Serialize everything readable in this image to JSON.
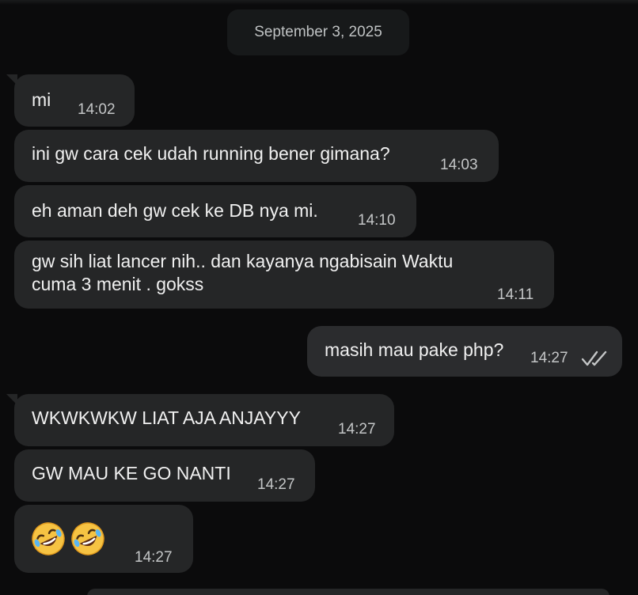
{
  "date_separator": "September 3, 2025",
  "messages": [
    {
      "direction": "in",
      "text": "mi",
      "time": "14:02"
    },
    {
      "direction": "in",
      "text": "ini gw cara cek udah running bener gimana?",
      "time": "14:03"
    },
    {
      "direction": "in",
      "text": "eh aman deh gw cek ke DB nya mi.",
      "time": "14:10"
    },
    {
      "direction": "in",
      "text": "gw sih liat lancer nih.. dan kayanya ngabisain Waktu\ncuma 3 menit . gokss",
      "time": "14:11"
    },
    {
      "direction": "out",
      "text": "masih mau pake php?",
      "time": "14:27",
      "status": "read-double-check"
    },
    {
      "direction": "in",
      "text": "WKWKWKW LIAT AJA ANJAYYY",
      "time": "14:27"
    },
    {
      "direction": "in",
      "text": "GW MAU KE GO NANTI",
      "time": "14:27"
    },
    {
      "direction": "in",
      "emojis": [
        "rolling-on-floor-laughing",
        "rolling-on-floor-laughing"
      ],
      "time": "14:27"
    }
  ],
  "colors": {
    "background": "#0b0b0c",
    "bubble_in": "#252627",
    "bubble_out": "#2b2c2e",
    "text": "#f0f0f0",
    "timestamp": "#c4c6c7"
  }
}
